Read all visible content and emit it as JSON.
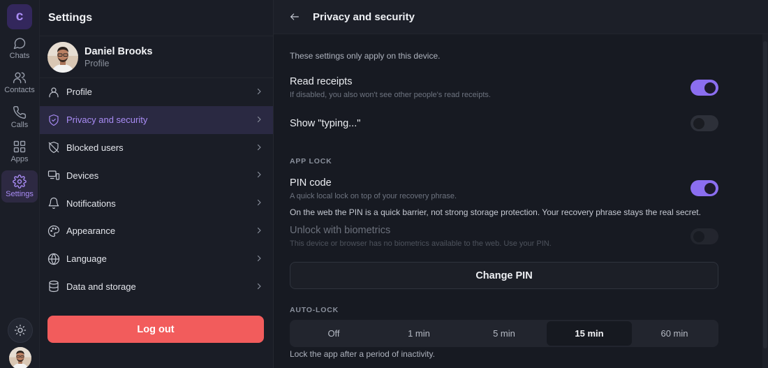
{
  "rail": {
    "logo_letter": "c",
    "items": [
      {
        "label": "Chats",
        "icon": "chat-bubble-icon"
      },
      {
        "label": "Contacts",
        "icon": "contacts-icon"
      },
      {
        "label": "Calls",
        "icon": "phone-icon"
      },
      {
        "label": "Apps",
        "icon": "apps-grid-icon"
      },
      {
        "label": "Settings",
        "icon": "gear-icon",
        "active": true
      }
    ]
  },
  "settings": {
    "title": "Settings",
    "profile": {
      "name": "Daniel Brooks",
      "subtitle": "Profile"
    },
    "menu": [
      {
        "label": "Profile",
        "icon": "user-icon"
      },
      {
        "label": "Privacy and security",
        "icon": "shield-icon",
        "active": true
      },
      {
        "label": "Blocked users",
        "icon": "blocked-shield-icon"
      },
      {
        "label": "Devices",
        "icon": "devices-icon"
      },
      {
        "label": "Notifications",
        "icon": "bell-icon"
      },
      {
        "label": "Appearance",
        "icon": "palette-icon"
      },
      {
        "label": "Language",
        "icon": "globe-icon"
      },
      {
        "label": "Data and storage",
        "icon": "database-icon"
      }
    ],
    "logout_label": "Log out"
  },
  "detail": {
    "title": "Privacy and security",
    "device_note": "These settings only apply on this device.",
    "read_receipts": {
      "title": "Read receipts",
      "subtitle": "If disabled, you also won't see other people's read receipts.",
      "enabled": true
    },
    "typing": {
      "title": "Show \"typing...\"",
      "enabled": false
    },
    "app_lock_section": "APP LOCK",
    "pin_code": {
      "title": "PIN code",
      "subtitle": "A quick local lock on top of your recovery phrase.",
      "enabled": true,
      "note": "On the web the PIN is a quick barrier, not strong storage protection. Your recovery phrase stays the real secret."
    },
    "biometrics": {
      "title": "Unlock with biometrics",
      "subtitle": "This device or browser has no biometrics available to the web. Use your PIN.",
      "enabled": false
    },
    "change_pin_label": "Change PIN",
    "auto_lock_section": "AUTO-LOCK",
    "auto_lock_options": [
      "Off",
      "1 min",
      "5 min",
      "15 min",
      "60 min"
    ],
    "auto_lock_selected": "15 min",
    "auto_lock_note": "Lock the app after a period of inactivity."
  },
  "colors": {
    "accent": "#8b6ef0",
    "accent_text": "#a98cf5",
    "logout": "#f25c5c",
    "background": "#171a22"
  }
}
